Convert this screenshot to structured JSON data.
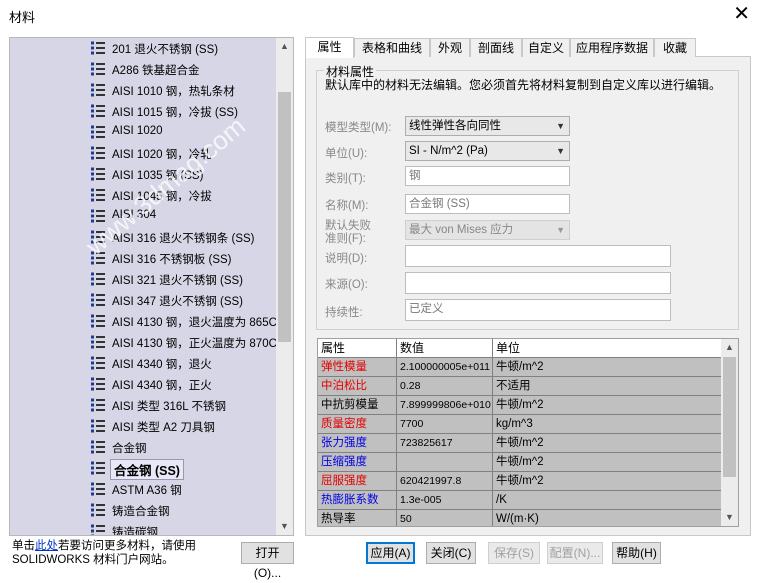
{
  "window": {
    "title": "材料",
    "close_glyph": "✕"
  },
  "tree": {
    "items": [
      {
        "label": "201 退火不锈钢 (SS)"
      },
      {
        "label": "A286 铁基超合金"
      },
      {
        "label": "AISI 1010 钢，热轧条材"
      },
      {
        "label": "AISI 1015 钢，冷拔 (SS)"
      },
      {
        "label": "AISI 1020"
      },
      {
        "label": "AISI 1020 钢，冷轧"
      },
      {
        "label": "AISI 1035 钢 (SS)"
      },
      {
        "label": "AISI 1045 钢，冷拔"
      },
      {
        "label": "AISI 304"
      },
      {
        "label": "AISI 316 退火不锈钢条 (SS)"
      },
      {
        "label": "AISI 316 不锈钢板 (SS)"
      },
      {
        "label": "AISI 321 退火不锈钢 (SS)"
      },
      {
        "label": "AISI 347 退火不锈钢 (SS)"
      },
      {
        "label": "AISI 4130 钢，退火温度为 865C"
      },
      {
        "label": "AISI 4130 钢，正火温度为 870C"
      },
      {
        "label": "AISI 4340 钢，退火"
      },
      {
        "label": "AISI 4340 钢，正火"
      },
      {
        "label": "AISI 类型 316L 不锈钢"
      },
      {
        "label": "AISI 类型 A2 刀具钢"
      },
      {
        "label": "合金钢"
      },
      {
        "label": "合金钢 (SS)",
        "selected": true
      },
      {
        "label": "ASTM A36 钢"
      },
      {
        "label": "铸造合金钢"
      },
      {
        "label": "铸造碳钢"
      }
    ]
  },
  "hint": {
    "prefix": "单击",
    "link": "此处",
    "suffix": "若要访问更多材料，请使用 SOLIDWORKS 材料门户网站。"
  },
  "buttons": {
    "open": "打开(O)...",
    "apply": "应用(A)",
    "close": "关闭(C)",
    "save": "保存(S)",
    "config": "配置(N)...",
    "help": "帮助(H)"
  },
  "tabs": [
    "属性",
    "表格和曲线",
    "外观",
    "剖面线",
    "自定义",
    "应用程序数据",
    "收藏"
  ],
  "properties": {
    "group_title": "材料属性",
    "notice": "默认库中的材料无法编辑。您必须首先将材料复制到自定义库以进行编辑。",
    "model_type_label": "模型类型(M):",
    "model_type_value": "线性弹性各向同性",
    "units_label": "单位(U):",
    "units_value": "SI - N/m^2 (Pa)",
    "category_label": "类别(T):",
    "category_value": "钢",
    "name_label": "名称(M):",
    "name_value": "合金钢 (SS)",
    "criterion_label_1": "默认失败",
    "criterion_label_2": "准则(F):",
    "criterion_value": "最大 von Mises 应力",
    "description_label": "说明(D):",
    "description_value": "",
    "source_label": "来源(O):",
    "source_value": "",
    "sustainability_label": "持续性:",
    "sustainability_value": "已定义"
  },
  "grid": {
    "headers": [
      "属性",
      "数值",
      "单位"
    ],
    "rows": [
      {
        "name": "弹性模量",
        "value": "2.100000005e+011",
        "unit": "牛顿/m^2",
        "color": "red"
      },
      {
        "name": "中泊松比",
        "value": "0.28",
        "unit": "不适用",
        "color": "red"
      },
      {
        "name": "中抗剪模量",
        "value": "7.899999806e+010",
        "unit": "牛顿/m^2",
        "color": "black"
      },
      {
        "name": "质量密度",
        "value": "7700",
        "unit": "kg/m^3",
        "color": "red"
      },
      {
        "name": "张力强度",
        "value": "723825617",
        "unit": "牛顿/m^2",
        "color": "blue"
      },
      {
        "name": "压缩强度",
        "value": "",
        "unit": "牛顿/m^2",
        "color": "blue"
      },
      {
        "name": "屈服强度",
        "value": "620421997.8",
        "unit": "牛顿/m^2",
        "color": "red"
      },
      {
        "name": "热膨胀系数",
        "value": "1.3e-005",
        "unit": "/K",
        "color": "blue"
      },
      {
        "name": "热导率",
        "value": "50",
        "unit": "W/(m·K)",
        "color": "black"
      }
    ]
  },
  "watermark": "www.3dmag.com"
}
